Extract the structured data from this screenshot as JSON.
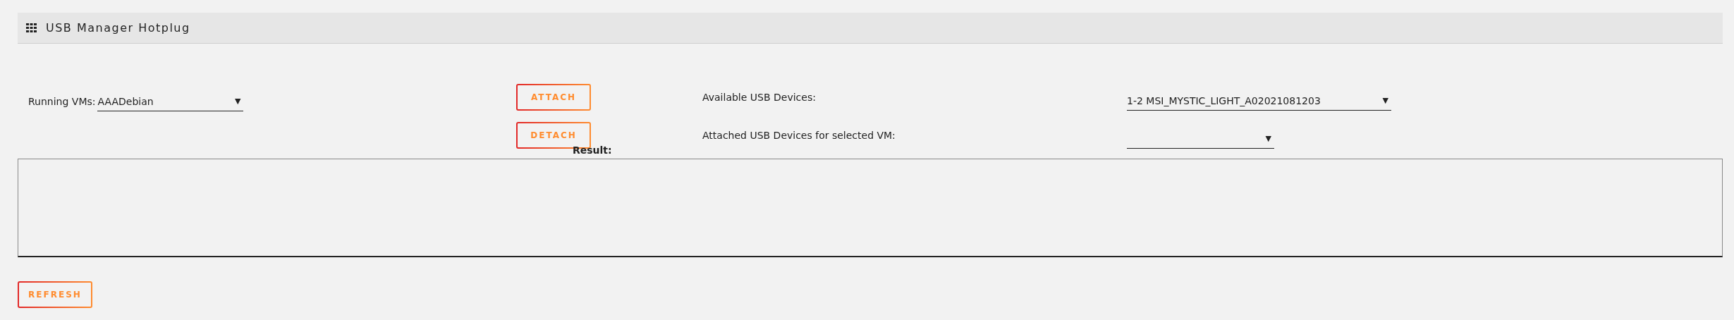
{
  "panel": {
    "title": "USB Manager Hotplug"
  },
  "running_vms": {
    "label": "Running VMs:",
    "value": "AAADebian",
    "caret": "▼"
  },
  "buttons": [
    {
      "label": "ATTACH"
    },
    {
      "label": "DETACH"
    }
  ],
  "available_usb_devices": {
    "label": "Available USB Devices:",
    "value": "1-2 MSI_MYSTIC_LIGHT_A02021081203",
    "caret": "▼"
  },
  "attached_usb_devices": {
    "label": "Attached USB Devices for selected VM:",
    "caret": "▼"
  },
  "result": {
    "label": "Result:"
  },
  "refresh_button": {
    "label": "REFRESH"
  }
}
